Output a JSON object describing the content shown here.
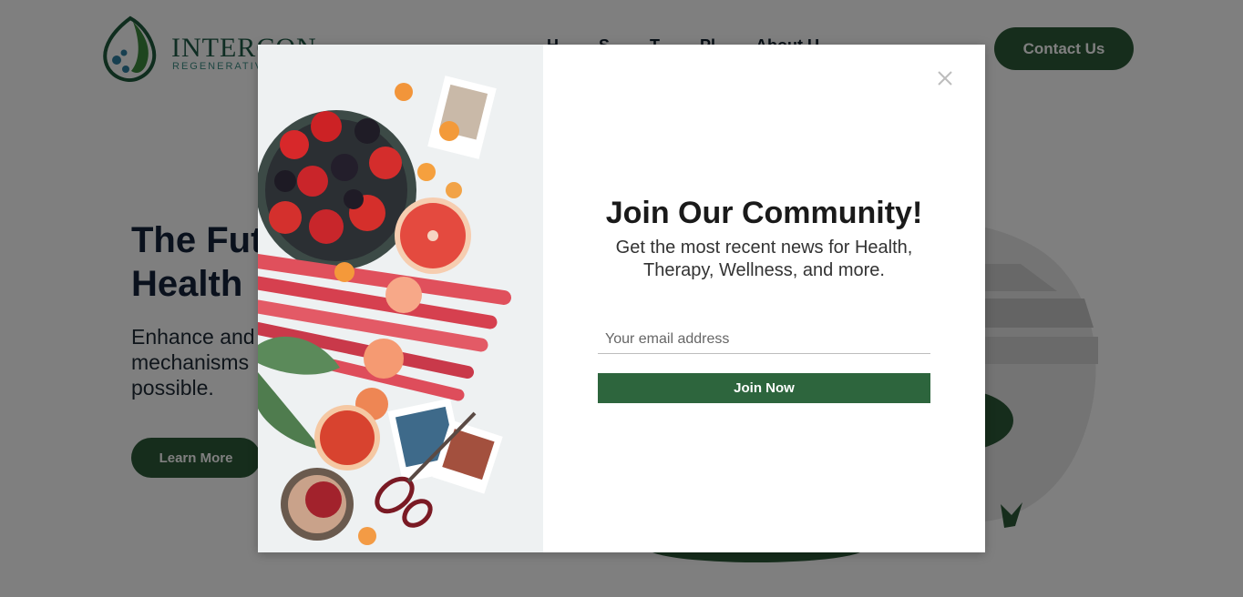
{
  "header": {
    "logo_name": "INTERCON",
    "logo_sub": "REGENERATIVE",
    "nav": [
      "H",
      "S",
      "T",
      "Pl",
      "About U"
    ],
    "contact_label": "Contact Us"
  },
  "hero": {
    "title_line1": "The Fut",
    "title_line2": "Health",
    "text_line1": "Enhance and",
    "text_line2": "mechanisms",
    "text_line3": "possible.",
    "cta_label": "Learn More"
  },
  "popup": {
    "title": "Join Our Community!",
    "subtitle_line1": "Get the most recent news for Health,",
    "subtitle_line2": "Therapy, Wellness, and more.",
    "email_placeholder": "Your email address",
    "submit_label": "Join Now",
    "close_icon": "close-icon"
  },
  "colors": {
    "brand_green": "#2d5a39",
    "button_green": "#2d653d",
    "overlay": "rgba(0,0,0,0.5)"
  }
}
